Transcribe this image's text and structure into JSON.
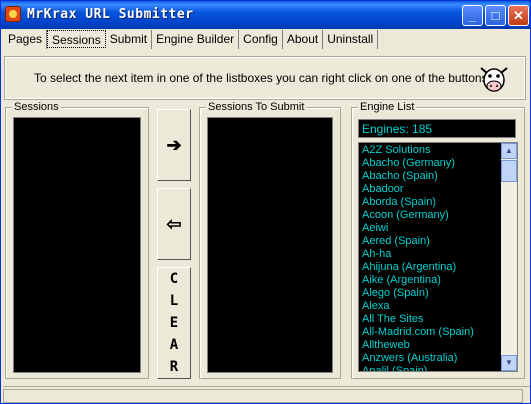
{
  "window": {
    "title": "MrKrax URL Submitter"
  },
  "titlebar_buttons": {
    "minimize": "_",
    "maximize": "□",
    "close": "✕"
  },
  "tabs": [
    {
      "label": "Pages",
      "active": false
    },
    {
      "label": "Sessions",
      "active": true
    },
    {
      "label": "Submit",
      "active": false
    },
    {
      "label": "Engine Builder",
      "active": false
    },
    {
      "label": "Config",
      "active": false
    },
    {
      "label": "About",
      "active": false
    },
    {
      "label": "Uninstall",
      "active": false
    }
  ],
  "banner": {
    "text": "To select the next item in one of the listboxes you can right click on one of the buttons..."
  },
  "sessions": {
    "label": "Sessions"
  },
  "to_submit": {
    "label": "Sessions To Submit"
  },
  "buttons": {
    "add": "➔",
    "remove": "⇦",
    "clear": [
      "C",
      "L",
      "E",
      "A",
      "R"
    ]
  },
  "engine_list": {
    "label": "Engine List",
    "count": "Engines: 185",
    "items": [
      "A2Z Solutions",
      "Abacho (Germany)",
      "Abacho (Spain)",
      "Abadoor",
      "Aborda (Spain)",
      "Acoon (Germany)",
      "Aeiwi",
      "Aered (Spain)",
      "Ah-ha",
      "Ahijuna (Argentina)",
      "Aike (Argentina)",
      "Alego (Spain)",
      "Alexa",
      "All The Sites",
      "All-Madrid.com (Spain)",
      "Alltheweb",
      "Anzwers (Australia)",
      "Apalil (Spain)"
    ]
  },
  "colors": {
    "titlebar": "#0855dd",
    "list_text": "#00d0d0",
    "face": "#ece9d8"
  }
}
